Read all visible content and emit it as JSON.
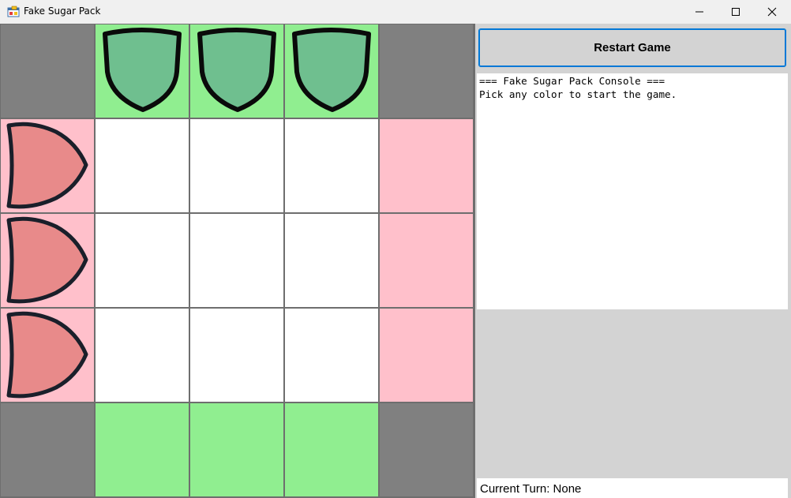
{
  "window": {
    "title": "Fake Sugar Pack",
    "icon": "app-window-icon",
    "controls": [
      "minimize-icon",
      "maximize-icon",
      "close-icon"
    ]
  },
  "board": {
    "rows": [
      [
        "gray",
        "green-piece",
        "green-piece",
        "green-piece",
        "gray"
      ],
      [
        "pink-piece",
        "white",
        "white",
        "white",
        "pink"
      ],
      [
        "pink-piece",
        "white",
        "white",
        "white",
        "pink"
      ],
      [
        "pink-piece",
        "white",
        "white",
        "white",
        "pink"
      ],
      [
        "gray",
        "green",
        "green",
        "green",
        "gray"
      ]
    ],
    "colors": {
      "gray": "#808080",
      "green": "#90ee90",
      "pink": "#ffc0cb",
      "white": "#ffffff",
      "green_piece_fill": "#6fbf8f",
      "pink_piece_fill": "#e88a8a"
    }
  },
  "side": {
    "restart_label": "Restart Game",
    "console_lines": [
      "=== Fake Sugar Pack Console ===",
      "Pick any color to start the game."
    ],
    "status_text": "Current Turn: None"
  }
}
